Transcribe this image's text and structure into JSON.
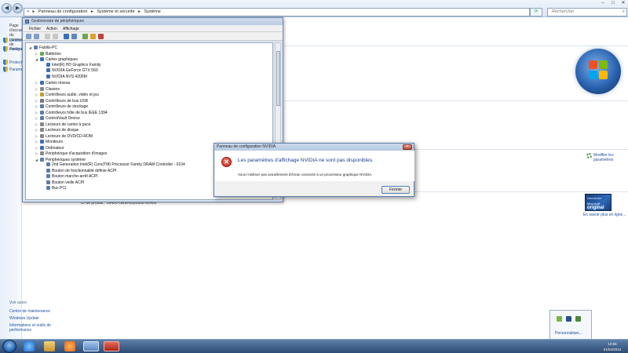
{
  "address_bar": {
    "segments": [
      "Panneau de configuration",
      "Système et sécurité",
      "Système"
    ],
    "separator": "▸"
  },
  "search": {
    "placeholder": "Rechercher"
  },
  "left_pane": {
    "header": "Page d'accueil du panneau de configuration",
    "links": [
      "Gestionnaire de périphériques",
      "Paramètres d'utilisation à distance",
      "Protection du système",
      "Paramètres système avancés"
    ],
    "see_also_label": "Voir aussi",
    "see_also_links": [
      "Centre de maintenance",
      "Windows Update",
      "Informations et outils de performance"
    ]
  },
  "device_manager": {
    "title": "Gestionnaire de périphériques",
    "menu": [
      "Fichier",
      "Action",
      "Affichage"
    ],
    "tree": [
      {
        "level": 0,
        "exp": "◢",
        "label": "Fabilis-PC",
        "color": "#5b7fb0"
      },
      {
        "level": 1,
        "exp": "▷",
        "label": "Batteries",
        "color": "#6aa84f"
      },
      {
        "level": 1,
        "exp": "◢",
        "label": "Cartes graphiques",
        "color": "#3d6fb6"
      },
      {
        "level": 2,
        "exp": "",
        "label": "Intel(R) HD Graphics Family",
        "color": "#3d6fb6"
      },
      {
        "level": 2,
        "exp": "",
        "label": "NVIDIA GeForce GTX 560",
        "color": "#3d6fb6"
      },
      {
        "level": 2,
        "exp": "",
        "label": "NVIDIA NVS 4200M",
        "color": "#3d6fb6"
      },
      {
        "level": 1,
        "exp": "▷",
        "label": "Cartes réseau",
        "color": "#3d6fb6"
      },
      {
        "level": 1,
        "exp": "▷",
        "label": "Claviers",
        "color": "#888888"
      },
      {
        "level": 1,
        "exp": "▷",
        "label": "Contrôleurs audio, vidéo et jeu",
        "color": "#c59b2b"
      },
      {
        "level": 1,
        "exp": "▷",
        "label": "Contrôleurs de bus USB",
        "color": "#777777"
      },
      {
        "level": 1,
        "exp": "▷",
        "label": "Contrôleurs de stockage",
        "color": "#5a7da8"
      },
      {
        "level": 1,
        "exp": "▷",
        "label": "Contrôleurs hôte de bus IEEE 1394",
        "color": "#5a7da8"
      },
      {
        "level": 1,
        "exp": "▷",
        "label": "ControlVault Device",
        "color": "#5a7da8"
      },
      {
        "level": 1,
        "exp": "▷",
        "label": "Lecteurs de cartes à puce",
        "color": "#888888"
      },
      {
        "level": 1,
        "exp": "▷",
        "label": "Lecteurs de disque",
        "color": "#888888"
      },
      {
        "level": 1,
        "exp": "▷",
        "label": "Lecteurs de DVD/CD-ROM",
        "color": "#888888"
      },
      {
        "level": 1,
        "exp": "▷",
        "label": "Moniteurs",
        "color": "#3d6fb6"
      },
      {
        "level": 1,
        "exp": "▷",
        "label": "Ordinateur",
        "color": "#3d6fb6"
      },
      {
        "level": 1,
        "exp": "▷",
        "label": "Périphérique d'acquisition d'images",
        "color": "#888888"
      },
      {
        "level": 1,
        "exp": "◢",
        "label": "Périphériques système",
        "color": "#5a7da8"
      },
      {
        "level": 2,
        "exp": "",
        "label": "2nd Generation Intel(R) Core(TM) Processor Family DRAM Controller - 0104",
        "color": "#5a7da8"
      },
      {
        "level": 2,
        "exp": "",
        "label": "Bouton de fonctionnalité définie ACPI",
        "color": "#5a7da8"
      },
      {
        "level": 2,
        "exp": "",
        "label": "Bouton marche-arrêt ACPI",
        "color": "#5a7da8"
      },
      {
        "level": 2,
        "exp": "",
        "label": "Bouton veille ACPI",
        "color": "#5a7da8"
      },
      {
        "level": 2,
        "exp": "",
        "label": "Bus PCI",
        "color": "#5a7da8"
      }
    ]
  },
  "dialog": {
    "title": "Panneau de configuration NVIDIA",
    "message": "Les paramètres d'affichage NVIDIA ne sont pas disponibles.",
    "detail": "Vous n'utilisez pas actuellement d'écran connecté à un processeur graphique NVIDIA.",
    "button": "Fermer",
    "close_glyph": "✕",
    "error_glyph": "✕"
  },
  "system_page": {
    "modify_link": "Modifier les paramètres",
    "product_id": "ID de produit : 00426-OEM-8992662-00400",
    "genuine_line1": "Demander",
    "genuine_line2": "Microsoft",
    "genuine_line3": "original",
    "learn_more": "En savoir plus en ligne..."
  },
  "notification": {
    "link": "Personnaliser..."
  },
  "taskbar": {
    "time": "10:55",
    "date": "01/04/2012"
  },
  "colors": {
    "accent": "#1f4f9f",
    "error": "#c0221a",
    "taskbar": "#2c4b73"
  }
}
